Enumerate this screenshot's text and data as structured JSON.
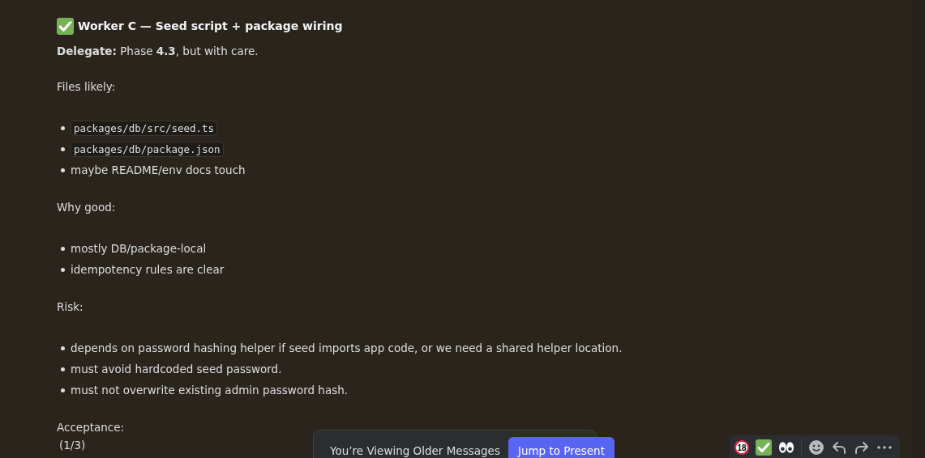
{
  "title": "Worker C — Seed script + package wiring",
  "delegate": "**Delegate:** Phase **4.3**, but with care.",
  "sections": [
    {
      "heading": "Files likely:",
      "items": [
        {
          "kind": "code",
          "text": "packages/db/src/seed.ts"
        },
        {
          "kind": "code",
          "text": "packages/db/package.json"
        },
        {
          "kind": "text",
          "text": "maybe README/env docs touch"
        }
      ]
    },
    {
      "heading": "Why good:",
      "items": [
        {
          "kind": "text",
          "text": "mostly DB/package-local"
        },
        {
          "kind": "text",
          "text": "idempotency rules are clear"
        }
      ]
    },
    {
      "heading": "Risk:",
      "items": [
        {
          "kind": "text",
          "text": "depends on password hashing helper if seed imports app code, or we need a shared helper location."
        },
        {
          "kind": "text",
          "text": "must avoid hardcoded seed password."
        },
        {
          "kind": "text",
          "text": "must not overwrite existing admin password hash."
        }
      ]
    },
    {
      "heading": "Acceptance:"
    }
  ],
  "page_count": "(1/3)",
  "notice": {
    "text": "You’re Viewing Older Messages",
    "button": "Jump to Present"
  },
  "reactions": {
    "age_badge": "18"
  }
}
